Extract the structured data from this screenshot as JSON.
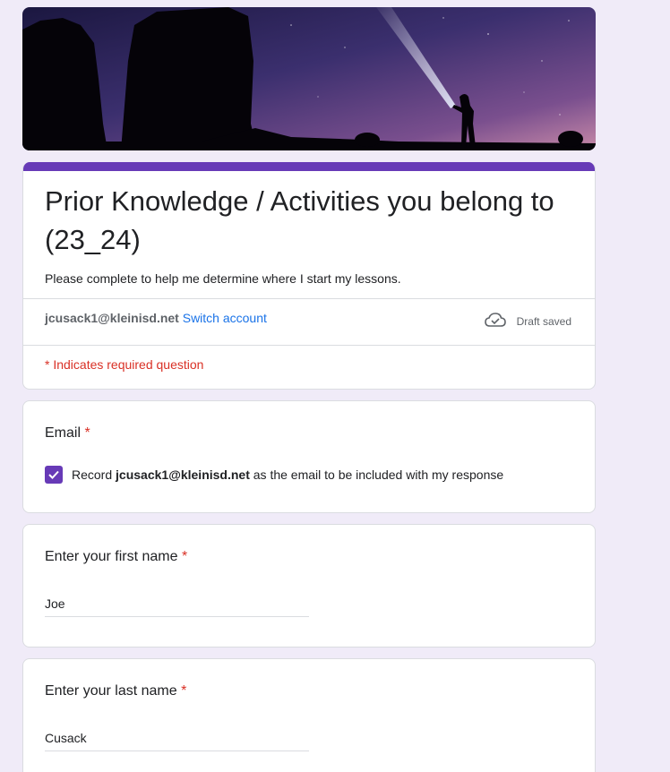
{
  "form": {
    "title": "Prior Knowledge / Activities you belong to (23_24)",
    "description": "Please complete to help me determine where I start my lessons.",
    "account_email": "jcusack1@kleinisd.net",
    "switch_account": "Switch account",
    "draft_status": "Draft saved",
    "required_note": "* Indicates required question",
    "accent_color": "#673ab7"
  },
  "questions": [
    {
      "title": "Email",
      "required_mark": "*",
      "checkbox_prefix": "Record",
      "checkbox_email": "jcusack1@kleinisd.net",
      "checkbox_suffix": "as the email to be included with my response",
      "checked": true
    },
    {
      "title": "Enter your first name",
      "required_mark": "*",
      "value": "Joe"
    },
    {
      "title": "Enter your last name",
      "required_mark": "*",
      "value": "Cusack"
    }
  ],
  "icons": {
    "draft": "cloud-check-icon",
    "checkbox": "checkmark-icon"
  }
}
